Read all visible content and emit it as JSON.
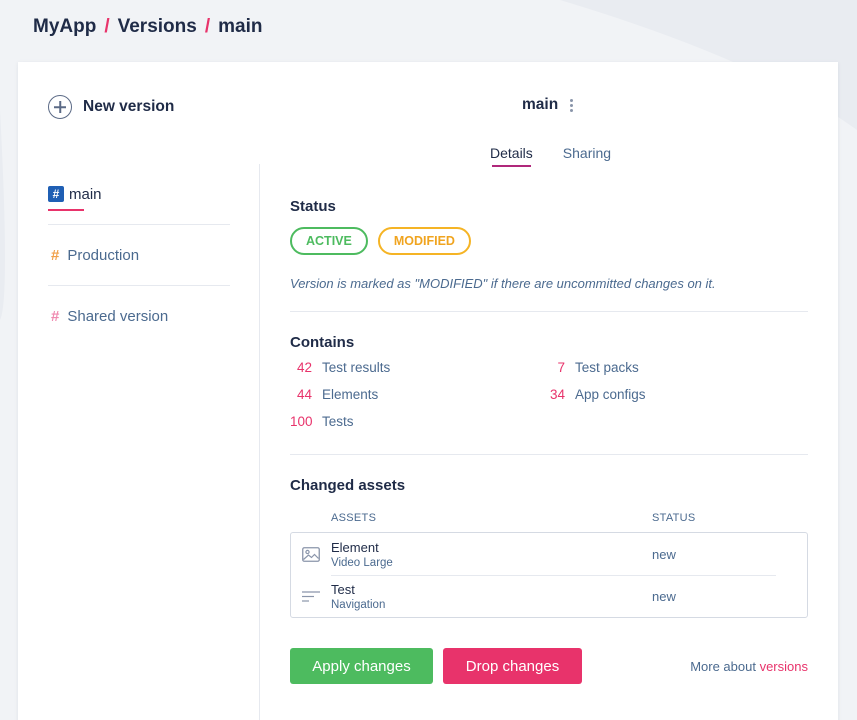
{
  "breadcrumb": {
    "items": [
      "MyApp",
      "Versions",
      "main"
    ],
    "separator": "/"
  },
  "sidebar": {
    "new_version_label": "New version",
    "items": [
      {
        "label": "main",
        "hash": "#",
        "color": "#1f5fb4"
      },
      {
        "label": "Production",
        "hash": "#",
        "color": "#f0a04b"
      },
      {
        "label": "Shared version",
        "hash": "#",
        "color": "#f08ab0"
      }
    ]
  },
  "header": {
    "version_title": "main"
  },
  "tabs": [
    {
      "label": "Details",
      "active": true
    },
    {
      "label": "Sharing",
      "active": false
    }
  ],
  "status": {
    "title": "Status",
    "badges": [
      {
        "label": "ACTIVE",
        "color": "#4dbb5f"
      },
      {
        "label": "MODIFIED",
        "color": "#f5b425"
      }
    ],
    "note": "Version is marked as \"MODIFIED\" if there are uncommitted changes on it."
  },
  "contains": {
    "title": "Contains",
    "items": [
      {
        "count": "42",
        "label": "Test results"
      },
      {
        "count": "7",
        "label": "Test packs"
      },
      {
        "count": "44",
        "label": "Elements"
      },
      {
        "count": "34",
        "label": "App configs"
      },
      {
        "count": "100",
        "label": "Tests"
      }
    ]
  },
  "changed_assets": {
    "title": "Changed assets",
    "columns": [
      "ASSETS",
      "STATUS"
    ],
    "rows": [
      {
        "icon": "image-icon",
        "name": "Element",
        "sub": "Video Large",
        "status": "new"
      },
      {
        "icon": "lines-icon",
        "name": "Test",
        "sub": "Navigation",
        "status": "new"
      }
    ]
  },
  "actions": {
    "apply_label": "Apply changes",
    "drop_label": "Drop changes",
    "more_text": "More about",
    "more_link": "versions"
  },
  "colors": {
    "accent": "#e8336b",
    "success": "#4dbb5f",
    "warning": "#f5b425",
    "text": "#1f2b47",
    "muted": "#4b6a8f"
  }
}
